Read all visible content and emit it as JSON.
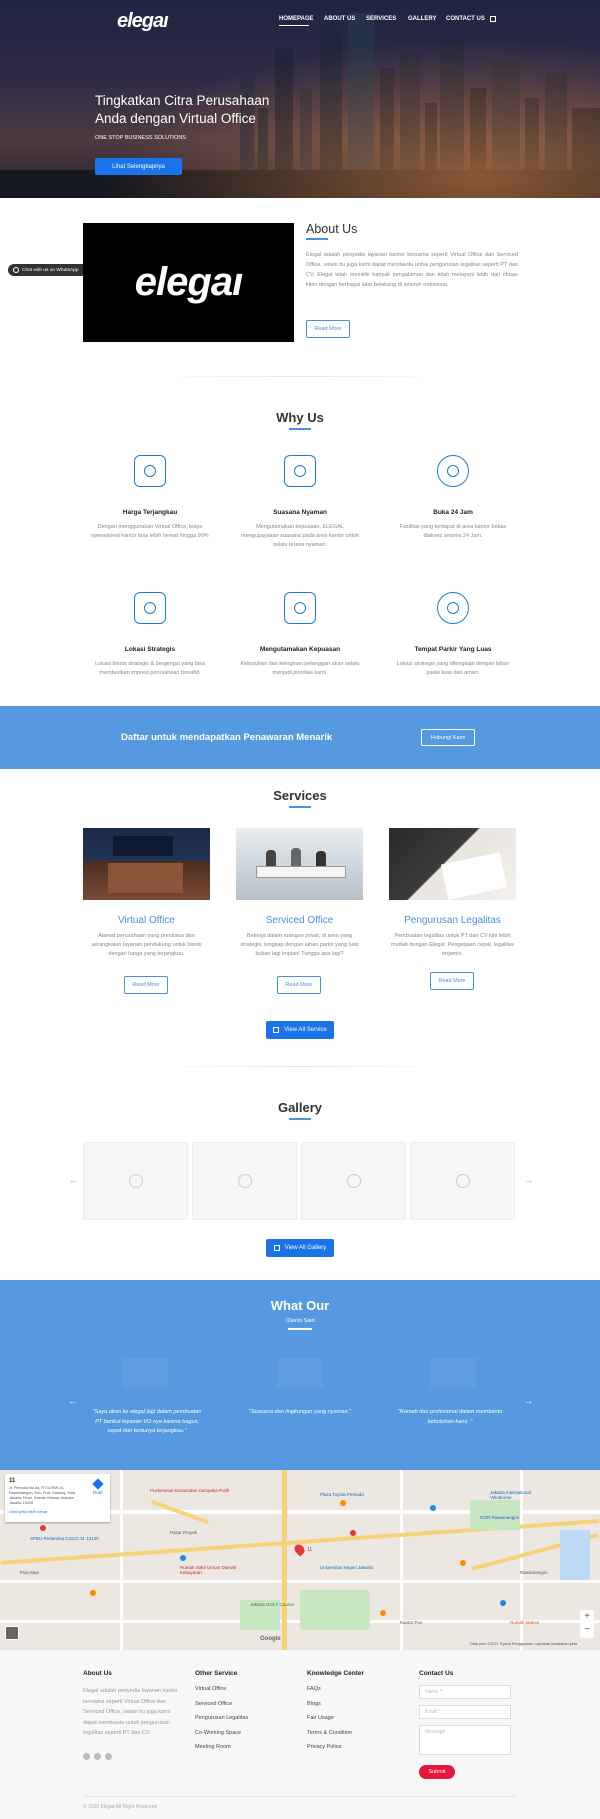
{
  "brand": {
    "logo": "elegaı"
  },
  "nav": {
    "items": [
      "HOMEPAGE",
      "ABOUT US",
      "SERVICES",
      "GALLERY",
      "CONTACT US"
    ]
  },
  "hero": {
    "title_line1": "Tingkatkan Citra Perusahaan",
    "title_line2": "Anda dengan Virtual Office",
    "subtitle": "ONE STOP BUSINESS SOLUTIONS",
    "button": "Lihat Selengkapnya"
  },
  "whatsapp": {
    "label": "Chat with us on WhatsApp"
  },
  "about": {
    "title": "About Us",
    "logo_text": "elegaı",
    "text": "Elegal adalah penyedia layanan kantor bersama seperti Virtual Office dan Serviced Office, selain itu juga kami dapat membantu untuk pengurusan legalitas seperti PT dan CV. Elegal telah memiliki banyak pengalaman dan telah melayani lebih dari ribuan klien dengan berbagai latar belakang di seluruh Indonesia.",
    "button": "Read More"
  },
  "why": {
    "title": "Why Us",
    "features": [
      {
        "icon": "money-hand-icon",
        "title": "Harga Terjangkau",
        "desc": "Dengan menggunakan Virtual Office, biaya operasional kantor bisa lebih hemat hingga 90%"
      },
      {
        "icon": "wind-icon",
        "title": "Suasana Nyaman",
        "desc": "Mengutamakan kepuasan, ELEGAL mengupayakan suasana pada area kantor untuk selalu terasa nyaman."
      },
      {
        "icon": "clock-24-icon",
        "title": "Buka 24 Jam",
        "desc": "Fasilitas yang terdapat di area kantor bebas diakses selama 24 Jam."
      },
      {
        "icon": "location-icon",
        "title": "Lokasi Strategis",
        "desc": "Lokasi bisnis strategis & bergengsi yang bisa memberikan impresi perusahaan bonafid."
      },
      {
        "icon": "thumbs-up-icon",
        "title": "Mengutamakan Kepuasan",
        "desc": "Kebutuhan dan keinginan pelanggan akan selalu menjadi prioritas kami."
      },
      {
        "icon": "parking-car-icon",
        "title": "Tempat Parkir Yang Luas",
        "desc": "Lokasi strategis yang dilengkapi dengan lahan parkir luas dan aman."
      }
    ]
  },
  "cta": {
    "text": "Daftar untuk mendapatkan Penawaran Menarik",
    "button": "Hubungi Kami"
  },
  "services": {
    "title": "Services",
    "items": [
      {
        "title": "Virtual Office",
        "desc": "Alamat perusahaan yang prestisius dan serangkaian layanan pendukung untuk bisnis dengan harga yang terjangkau.",
        "button": "Read More"
      },
      {
        "title": "Serviced Office",
        "desc": "Bekerja dalam ruangan privat, di area yang strategis, lengkap dengan lahan parkir yang luas bukan lagi impian! Tunggu apa lagi?",
        "button": "Read More"
      },
      {
        "title": "Pengurusan Legalitas",
        "desc": "Pembuatan legalitas untuk PT dan CV kini lebih mudah dengan Elegal. Pengerjaan cepat, legalitas terjamin.",
        "button": "Read More"
      }
    ],
    "view_all": "View All Service"
  },
  "gallery": {
    "title": "Gallery",
    "view_all": "View All Gallery"
  },
  "testimonials": {
    "title": "What Our",
    "subtitle": "Clients Said",
    "quotes": [
      "\"Saya akan ke elegal lagi dalam pembuatan PT berikut layanan VO nya karena bagus, cepat dan tentunya terjangkau.\"",
      "\"Suasana dan lingkungan yang nyaman.\"",
      "\"Ramah dan profesional dalam membantu kebutuhan kami. \""
    ]
  },
  "map": {
    "card_title": "11",
    "card_address": "Jl. Pemuda No.5a, RT.11/RW.14, Rawamangun, Kec. Pulo Gadung, Kota Jakarta Timur, Daerah Khusus Ibukota Jakarta 13220",
    "card_link": "Lihat peta lebih besar",
    "directions": "Rute",
    "pin_label": "11",
    "labels": [
      "Puskesmas Kecamatan Cempaka Putih",
      "Plaza Toyota Pemuda",
      "Rawamangun",
      "SPBU Pertamina COCO 31 13120",
      "Rumah Sakit Umum Daerah Kebayoran",
      "Jakarta International Velodrome",
      "GOR Rawamangun",
      "Universitas Negeri Jakarta",
      "Jakarta GOLF Course",
      "Pasar Proyek",
      "Rumah Makan",
      "Kantor Pos",
      "Pulo Mas"
    ],
    "footer_text": "Data peta ©2021   Syarat Penggunaan   Laporkan kesalahan peta",
    "google": "Google"
  },
  "footer": {
    "about_title": "About Us",
    "about_text": "Elegal adalah penyedia layanan kantor bersama seperti Virtual Office dan Serviced Office, selain itu juga kami dapat membantu untuk pengurusan legalitas seperti PT dan CV.",
    "other_title": "Other Service",
    "other_links": [
      "Virtual Office",
      "Serviced Office",
      "Pengurusan Legalitas",
      "Co-Working Space",
      "Meeting Room"
    ],
    "kc_title": "Knowledge Center",
    "kc_links": [
      "FAQs",
      "Blogs",
      "Fair Usage",
      "Terms & Condition",
      "Privacy Police"
    ],
    "contact_title": "Contact Us",
    "name_placeholder": "Name *",
    "email_placeholder": "Email *",
    "message_placeholder": "Message",
    "submit": "Submit",
    "copyright": "© 2020 Elegal All Right Reserved"
  },
  "colors": {
    "accent": "#4a90e2",
    "primary_button": "#1a73e8",
    "submit": "#e5173f",
    "band": "#5599e0"
  }
}
